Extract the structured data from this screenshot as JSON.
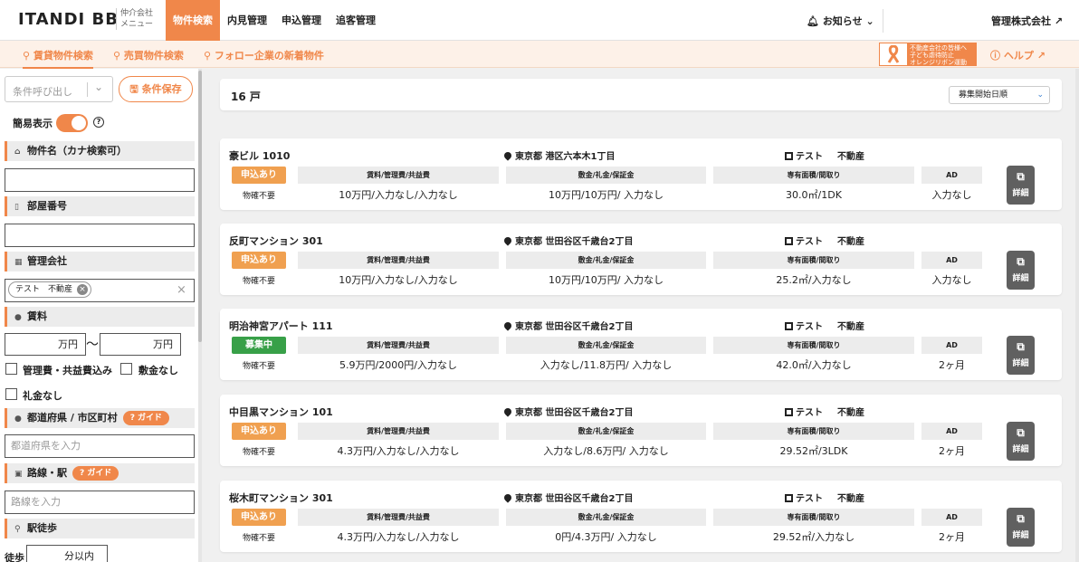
{
  "header": {
    "logo": "ITANDI BB",
    "logo_sub_line1": "仲介会社",
    "logo_sub_line2": "メニュー",
    "nav": [
      {
        "label": "物件検索",
        "active": true
      },
      {
        "label": "内見管理",
        "active": false
      },
      {
        "label": "申込管理",
        "active": false
      },
      {
        "label": "追客管理",
        "active": false
      }
    ],
    "notice_label": "お知らせ",
    "company_label": "管理株式会社"
  },
  "subnav": {
    "tabs": [
      {
        "label": "賃貸物件検索",
        "active": true
      },
      {
        "label": "売買物件検索",
        "active": false
      },
      {
        "label": "フォロー企業の新着物件",
        "active": false
      }
    ],
    "banner_line1": "不動産会社の皆様へ",
    "banner_line2": "子ども虐待防止",
    "banner_line3": "オレンジリボン運動",
    "help_label": "ヘルプ"
  },
  "sidebar": {
    "condition_placeholder": "条件呼び出し",
    "save_label": "条件保存",
    "simple_label": "簡易表示",
    "sections": {
      "building_name": "物件名（カナ検索可）",
      "room_number": "部屋番号",
      "management": "管理会社",
      "rent": "賃料",
      "area": "都道府県 / 市区町村",
      "line": "路線・駅",
      "walk": "駅徒歩"
    },
    "management_chip": "テスト　不動産",
    "rent_min_unit": "万円",
    "rent_max_unit": "万円",
    "checkbox_fees": "管理費・共益費込み",
    "checkbox_deposit": "敷金なし",
    "checkbox_keymoney": "礼金なし",
    "guide_label": "ガイド",
    "area_placeholder": "都道府県を入力",
    "line_placeholder": "路線を入力",
    "walk_label": "徒歩",
    "walk_unit": "分以内"
  },
  "results": {
    "count": "16 戸",
    "sort_label": "募集開始日順",
    "col_rent": "賃料/管理費/共益費",
    "col_deposit": "敷金/礼金/保証金",
    "col_area": "専有面積/間取り",
    "col_ad": "AD",
    "detail_label": "詳細",
    "company_name": "テスト",
    "company_type": "不動産",
    "listings": [
      {
        "name": "豪ビル 1010",
        "address": "東京都 港区六本木1丁目",
        "status": "申込あり",
        "status_type": "applied",
        "keymoney_note": "物確不要",
        "rent": "10万円/入力なし/入力なし",
        "deposit": "10万円/10万円/ 入力なし",
        "area": "30.0㎡/1DK",
        "ad": "入力なし"
      },
      {
        "name": "反町マンション 301",
        "address": "東京都 世田谷区千歳台2丁目",
        "status": "申込あり",
        "status_type": "applied",
        "keymoney_note": "物確不要",
        "rent": "10万円/入力なし/入力なし",
        "deposit": "10万円/10万円/ 入力なし",
        "area": "25.2㎡/入力なし",
        "ad": "入力なし"
      },
      {
        "name": "明治神宮アパート 111",
        "address": "東京都 世田谷区千歳台2丁目",
        "status": "募集中",
        "status_type": "recruit",
        "keymoney_note": "物確不要",
        "rent": "5.9万円/2000円/入力なし",
        "deposit": "入力なし/11.8万円/ 入力なし",
        "area": "42.0㎡/入力なし",
        "ad": "2ヶ月"
      },
      {
        "name": "中目黒マンション 101",
        "address": "東京都 世田谷区千歳台2丁目",
        "status": "申込あり",
        "status_type": "applied",
        "keymoney_note": "物確不要",
        "rent": "4.3万円/入力なし/入力なし",
        "deposit": "入力なし/8.6万円/ 入力なし",
        "area": "29.52㎡/3LDK",
        "ad": "2ヶ月"
      },
      {
        "name": "桜木町マンション 301",
        "address": "東京都 世田谷区千歳台2丁目",
        "status": "申込あり",
        "status_type": "applied",
        "keymoney_note": "物確不要",
        "rent": "4.3万円/入力なし/入力なし",
        "deposit": "0円/4.3万円/ 入力なし",
        "area": "29.52㎡/入力なし",
        "ad": "2ヶ月"
      }
    ]
  },
  "colors": {
    "accent": "#f0874a",
    "recruit": "#38a048",
    "applied": "#f0a050"
  },
  "icons": [
    "bell-icon",
    "external-link-icon",
    "search-icon",
    "help-circle-icon",
    "location-pin-icon",
    "building-icon",
    "door-icon",
    "yen-icon",
    "train-icon",
    "walk-icon",
    "home-icon"
  ]
}
